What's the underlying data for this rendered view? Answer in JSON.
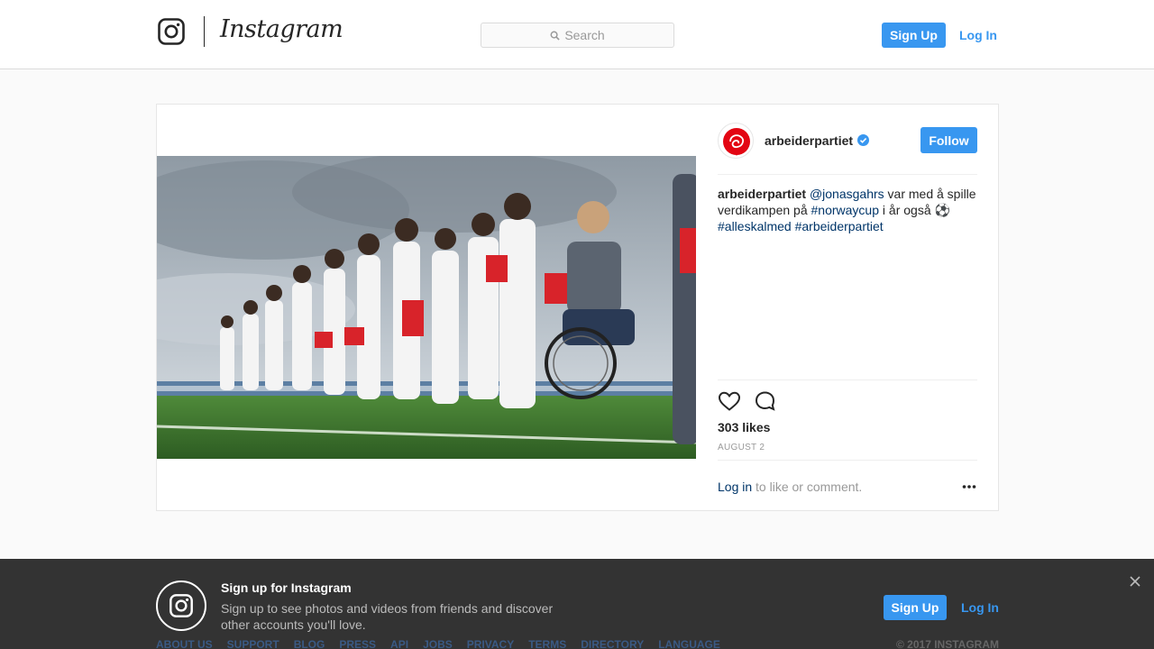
{
  "header": {
    "logo_text": "Instagram",
    "search_placeholder": "Search",
    "signup_label": "Sign Up",
    "login_label": "Log In"
  },
  "post": {
    "username": "arbeiderpartiet",
    "follow_label": "Follow",
    "caption": {
      "author": "arbeiderpartiet",
      "mention": "@jonasgahrs",
      "text1": " var med å spille verdikampen på ",
      "hashtag1": "#norwaycup",
      "text2": " i år også ⚽",
      "hashtag2": "#alleskalmed",
      "hashtag3": "#arbeiderpartiet"
    },
    "likes": "303 likes",
    "date": "AUGUST 2",
    "login_link": "Log in",
    "login_suffix": " to like or comment."
  },
  "banner": {
    "title": "Sign up for Instagram",
    "text": "Sign up to see photos and videos from friends and discover other accounts you'll love.",
    "signup_label": "Sign Up",
    "login_label": "Log In"
  },
  "footer": {
    "links": [
      "ABOUT US",
      "SUPPORT",
      "BLOG",
      "PRESS",
      "API",
      "JOBS",
      "PRIVACY",
      "TERMS",
      "DIRECTORY",
      "LANGUAGE"
    ],
    "copyright": "© 2017 INSTAGRAM"
  },
  "colors": {
    "accent": "#3897f0",
    "link": "#003569",
    "banner_bg": "#333333",
    "brand_red": "#e30613"
  },
  "icons": [
    "instagram-camera-icon",
    "search-icon",
    "verified-badge-icon",
    "heart-icon",
    "comment-icon",
    "more-options-icon",
    "close-icon"
  ]
}
